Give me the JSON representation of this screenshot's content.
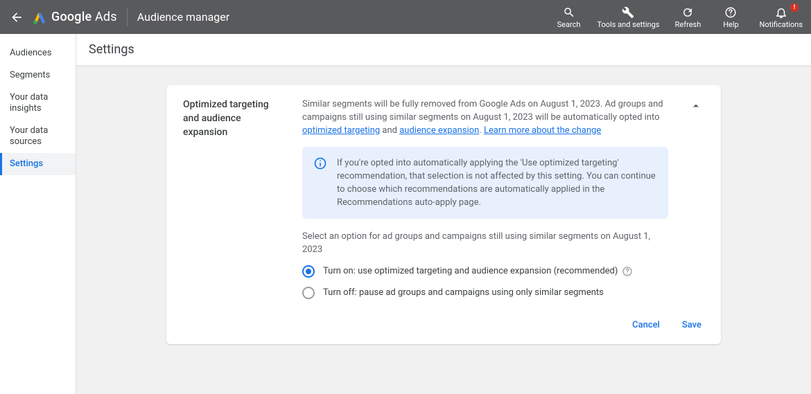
{
  "header": {
    "product_strong": "Google",
    "product_rest": " Ads",
    "module": "Audience manager",
    "actions": {
      "search": "Search",
      "tools": "Tools and settings",
      "refresh": "Refresh",
      "help": "Help",
      "notifications": "Notifications",
      "notif_badge": "!"
    }
  },
  "sidebar": {
    "items": [
      {
        "label": "Audiences"
      },
      {
        "label": "Segments"
      },
      {
        "label": "Your data insights"
      },
      {
        "label": "Your data sources"
      },
      {
        "label": "Settings"
      }
    ]
  },
  "page": {
    "title": "Settings"
  },
  "card": {
    "section_title": "Optimized targeting and audience expansion",
    "intro_pre": "Similar segments will be fully removed from Google Ads on August 1, 2023. Ad groups and campaigns still using similar segments on August 1, 2023 will be automatically opted into ",
    "link_opt": "optimized targeting",
    "intro_mid": " and ",
    "link_exp": "audience expansion",
    "intro_post": ". ",
    "link_learn": "Learn more about the change",
    "info": "If you're opted into automatically applying the 'Use optimized targeting' recommendation, that selection is not affected by this setting. You can continue to choose which recommendations are automatically applied in the Recommendations auto-apply page.",
    "select_text": "Select an option for ad groups and campaigns still using similar segments on August 1, 2023",
    "opt_on": "Turn on: use optimized targeting and audience expansion (recommended)",
    "opt_off": "Turn off: pause ad groups and campaigns using only similar segments",
    "cancel": "Cancel",
    "save": "Save"
  }
}
